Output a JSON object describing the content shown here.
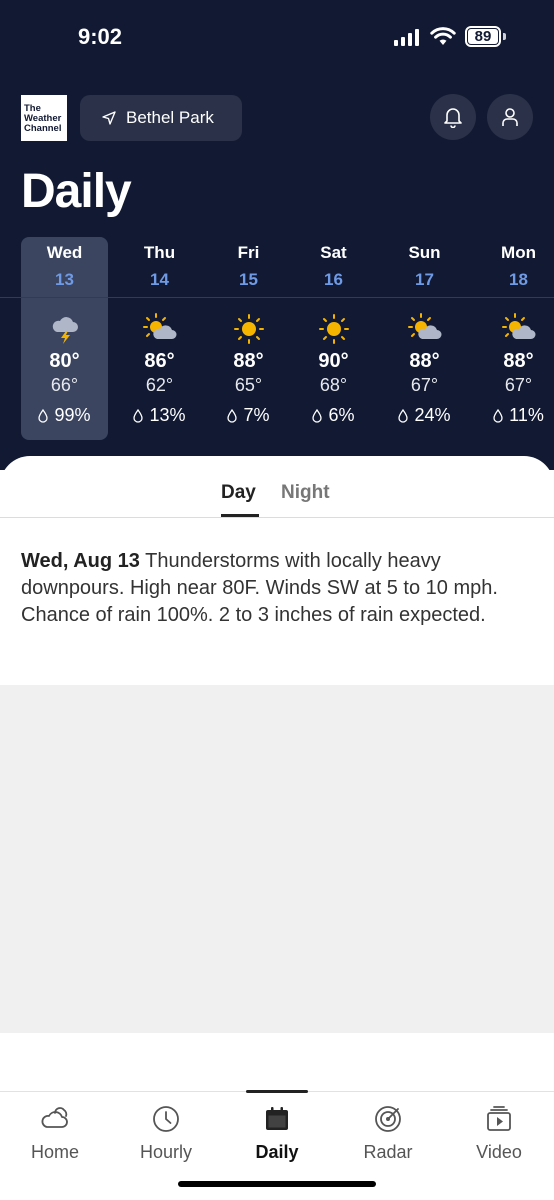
{
  "status_bar": {
    "time": "9:02",
    "battery": "89"
  },
  "header": {
    "logo_lines": [
      "The",
      "Weather",
      "Channel"
    ],
    "location": "Bethel Park",
    "icons": {
      "location": "location-arrow-icon",
      "notifications": "bell-icon",
      "profile": "person-icon"
    }
  },
  "page": {
    "title": "Daily"
  },
  "days": [
    {
      "name": "Wed",
      "date": "13",
      "icon": "thunderstorm-icon",
      "high": "80°",
      "low": "66°",
      "precip": "99%",
      "selected": true
    },
    {
      "name": "Thu",
      "date": "14",
      "icon": "partly-cloudy-icon",
      "high": "86°",
      "low": "62°",
      "precip": "13%"
    },
    {
      "name": "Fri",
      "date": "15",
      "icon": "sunny-icon",
      "high": "88°",
      "low": "65°",
      "precip": "7%"
    },
    {
      "name": "Sat",
      "date": "16",
      "icon": "sunny-icon",
      "high": "90°",
      "low": "68°",
      "precip": "6%"
    },
    {
      "name": "Sun",
      "date": "17",
      "icon": "partly-cloudy-icon",
      "high": "88°",
      "low": "67°",
      "precip": "24%"
    },
    {
      "name": "Mon",
      "date": "18",
      "icon": "partly-cloudy-icon",
      "high": "88°",
      "low": "67°",
      "precip": "11%"
    }
  ],
  "detail": {
    "tabs": {
      "day": "Day",
      "night": "Night",
      "active": "Day"
    },
    "date_label": "Wed, Aug 13",
    "text": "Thunderstorms with locally heavy downpours. High near 80F. Winds SW at 5 to 10 mph. Chance of rain 100%. 2 to 3 inches of rain expected."
  },
  "bottom_nav": {
    "items": [
      {
        "label": "Home",
        "icon": "home-cloud-icon"
      },
      {
        "label": "Hourly",
        "icon": "clock-icon"
      },
      {
        "label": "Daily",
        "icon": "calendar-icon",
        "active": true
      },
      {
        "label": "Radar",
        "icon": "radar-icon"
      },
      {
        "label": "Video",
        "icon": "video-icon"
      }
    ]
  },
  "colors": {
    "hero_bg": "#121a33",
    "date_accent": "#6f9ae6",
    "sun": "#f5b400",
    "cloud": "#aeb6c8",
    "selected_day_bg": "#3b4560"
  }
}
